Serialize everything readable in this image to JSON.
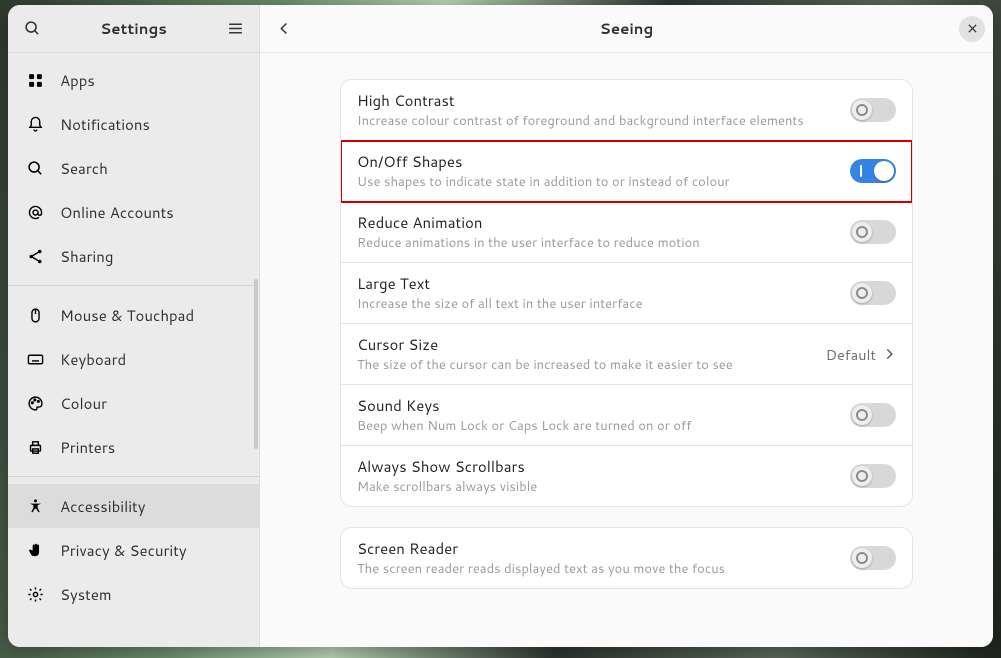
{
  "sidebar": {
    "title": "Settings",
    "groups": [
      [
        {
          "icon": "apps",
          "label": "Apps"
        },
        {
          "icon": "bell",
          "label": "Notifications"
        },
        {
          "icon": "search",
          "label": "Search"
        },
        {
          "icon": "at",
          "label": "Online Accounts"
        },
        {
          "icon": "share",
          "label": "Sharing"
        }
      ],
      [
        {
          "icon": "mouse",
          "label": "Mouse & Touchpad"
        },
        {
          "icon": "keyboard",
          "label": "Keyboard"
        },
        {
          "icon": "palette",
          "label": "Colour"
        },
        {
          "icon": "printer",
          "label": "Printers"
        }
      ],
      [
        {
          "icon": "accessibility",
          "label": "Accessibility",
          "selected": true
        },
        {
          "icon": "hand",
          "label": "Privacy & Security"
        },
        {
          "icon": "gear",
          "label": "System"
        }
      ]
    ]
  },
  "main": {
    "title": "Seeing",
    "cursor_value": "Default",
    "groups": [
      {
        "rows": [
          {
            "title": "High Contrast",
            "desc": "Increase colour contrast of foreground and background interface elements",
            "control": "switch",
            "state": "off"
          },
          {
            "title": "On/Off Shapes",
            "desc": "Use shapes to indicate state in addition to or instead of colour",
            "control": "switch",
            "state": "on",
            "highlight": true
          },
          {
            "title": "Reduce Animation",
            "desc": "Reduce animations in the user interface to reduce motion",
            "control": "switch",
            "state": "off"
          },
          {
            "title": "Large Text",
            "desc": "Increase the size of all text in the user interface",
            "control": "switch",
            "state": "off"
          },
          {
            "title": "Cursor Size",
            "desc": "The size of the cursor can be increased to make it easier to see",
            "control": "link"
          },
          {
            "title": "Sound Keys",
            "desc": "Beep when Num Lock or Caps Lock are turned on or off",
            "control": "switch",
            "state": "off"
          },
          {
            "title": "Always Show Scrollbars",
            "desc": "Make scrollbars always visible",
            "control": "switch",
            "state": "off"
          }
        ]
      },
      {
        "rows": [
          {
            "title": "Screen Reader",
            "desc": "The screen reader reads displayed text as you move the focus",
            "control": "switch",
            "state": "off"
          }
        ]
      }
    ]
  }
}
